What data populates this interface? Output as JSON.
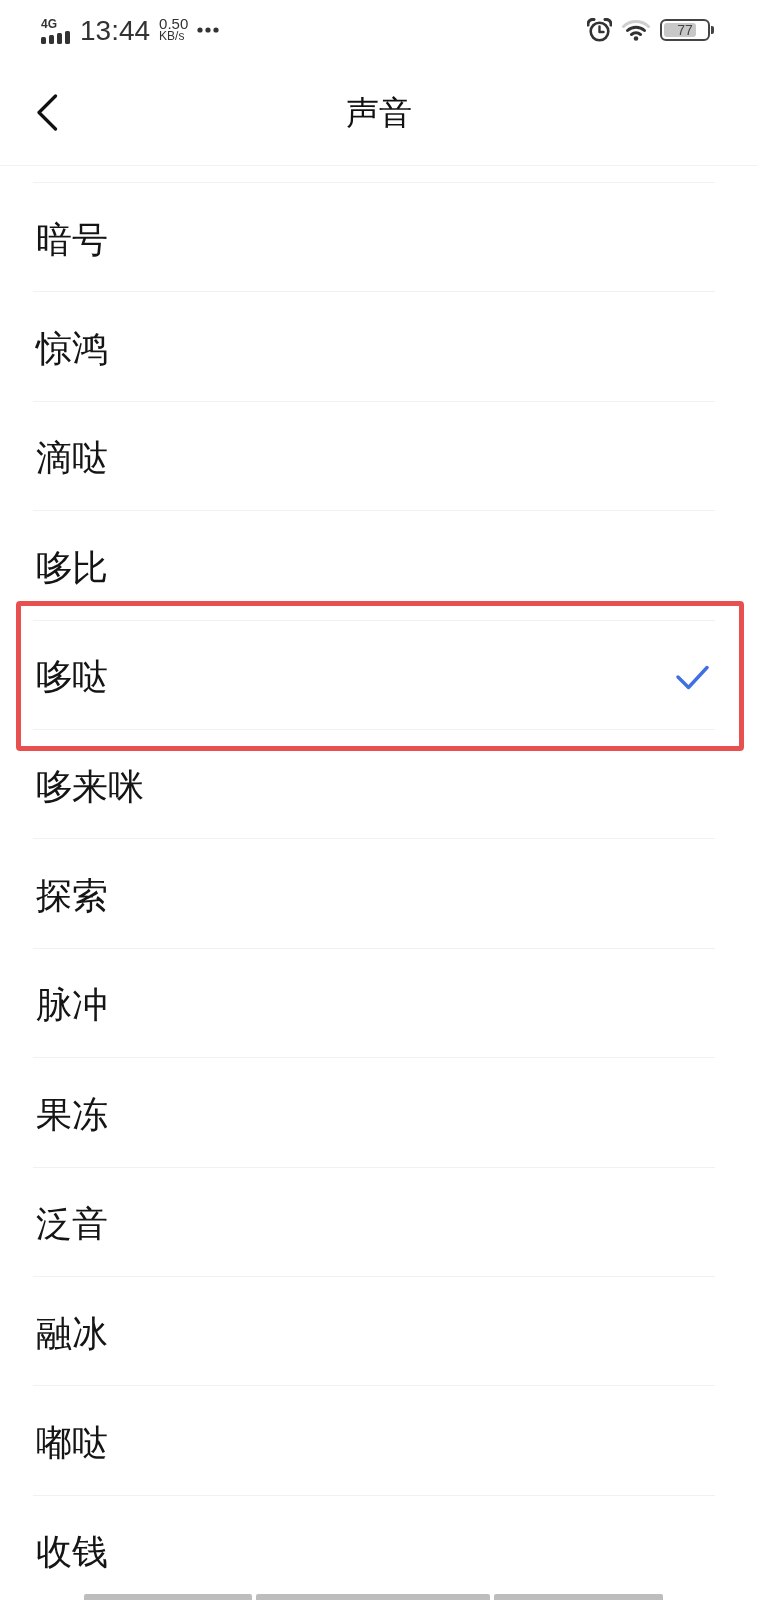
{
  "status_bar": {
    "network": "4G",
    "time": "13:44",
    "speed": "0.50",
    "speed_unit": "KB/s",
    "battery": "77"
  },
  "header": {
    "title": "声音"
  },
  "items": [
    {
      "label": "暗号",
      "selected": false,
      "highlighted": false
    },
    {
      "label": "惊鸿",
      "selected": false,
      "highlighted": false
    },
    {
      "label": "滴哒",
      "selected": false,
      "highlighted": false
    },
    {
      "label": "哆比",
      "selected": false,
      "highlighted": false
    },
    {
      "label": "哆哒",
      "selected": true,
      "highlighted": true
    },
    {
      "label": "哆来咪",
      "selected": false,
      "highlighted": false
    },
    {
      "label": "探索",
      "selected": false,
      "highlighted": false
    },
    {
      "label": "脉冲",
      "selected": false,
      "highlighted": false
    },
    {
      "label": "果冻",
      "selected": false,
      "highlighted": false
    },
    {
      "label": "泛音",
      "selected": false,
      "highlighted": false
    },
    {
      "label": "融冰",
      "selected": false,
      "highlighted": false
    },
    {
      "label": "嘟哒",
      "selected": false,
      "highlighted": false
    },
    {
      "label": "收钱",
      "selected": false,
      "highlighted": false
    }
  ]
}
